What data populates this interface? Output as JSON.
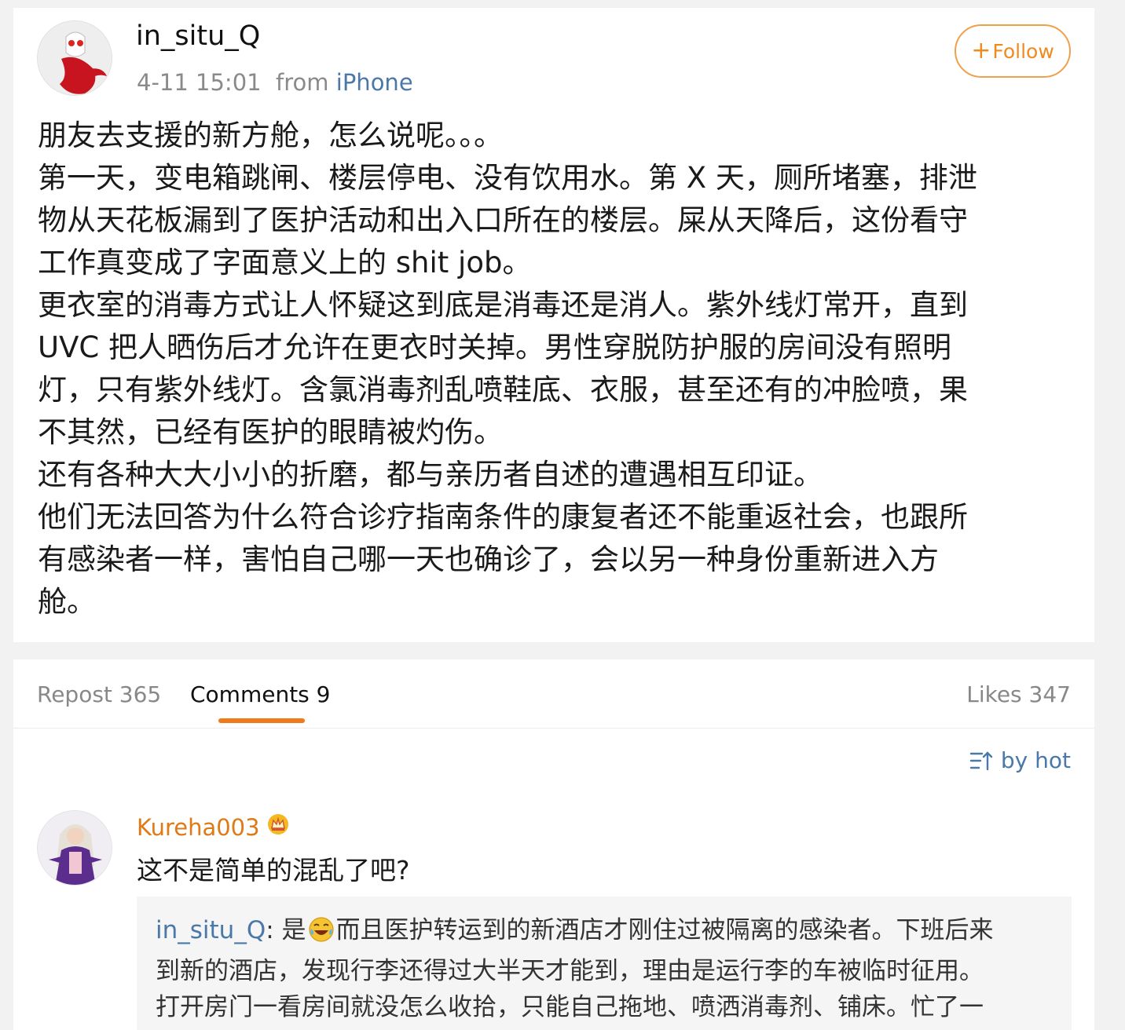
{
  "post": {
    "username": "in_situ_Q",
    "time": "4-11 15:01",
    "from_label": "from",
    "source": "iPhone",
    "follow_label": "Follow",
    "lines": [
      "朋友去支援的新方舱，怎么说呢。。。",
      "第一天，变电箱跳闸、楼层停电、没有饮用水。第 X 天，厕所堵塞，排泄",
      "物从天花板漏到了医护活动和出入口所在的楼层。屎从天降后，这份看守",
      "工作真变成了字面意义上的 shit job。",
      "更衣室的消毒方式让人怀疑这到底是消毒还是消人。紫外线灯常开，直到",
      "UVC 把人晒伤后才允许在更衣时关掉。男性穿脱防护服的房间没有照明",
      "灯，只有紫外线灯。含氯消毒剂乱喷鞋底、衣服，甚至还有的冲脸喷，果",
      "不其然，已经有医护的眼睛被灼伤。",
      "还有各种大大小小的折磨，都与亲历者自述的遭遇相互印证。",
      "他们无法回答为什么符合诊疗指南条件的康复者还不能重返社会，也跟所",
      "有感染者一样，害怕自己哪一天也确诊了，会以另一种身份重新进入方",
      "舱。"
    ]
  },
  "tabs": {
    "repost": "Repost 365",
    "comments": "Comments 9",
    "likes": "Likes 347"
  },
  "sort_label": "by hot",
  "comment": {
    "username": "Kureha003",
    "text": "这不是简单的混乱了吧?",
    "reply": {
      "username": "in_situ_Q",
      "separator": ":",
      "line1_a": " 是",
      "line1_b": "而且医护转运到的新酒店才刚住过被隔离的感染者。下班后来",
      "line2": "到新的酒店，发现行李还得过大半天才能到，理由是运行李的车被临时征用。",
      "line3": "打开房门一看房间就没怎么收拾，只能自己拖地、喷洒消毒剂、铺床。忙了一"
    }
  },
  "colors": {
    "accent_orange": "#f07a19",
    "link_blue": "#4a78a8"
  },
  "icons": {
    "sort": "sort-icon",
    "crown": "crown-badge-icon",
    "emoji": "laughing-crying-emoji"
  }
}
